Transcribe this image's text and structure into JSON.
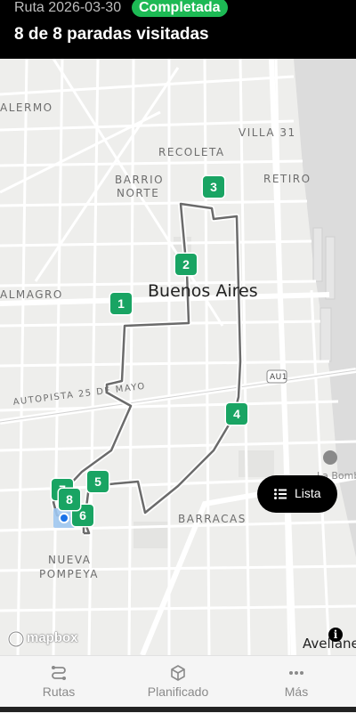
{
  "header": {
    "route_date": "Ruta 2026-03-30",
    "status": "Completada",
    "title": "8 de 8 paradas visitadas"
  },
  "map": {
    "city": "Buenos Aires",
    "labels": {
      "almagro_top": "ALERMO",
      "recoleta": "RECOLETA",
      "villa31": "VILLA 31",
      "barrio_norte_1": "BARRIO",
      "barrio_norte_2": "NORTE",
      "retiro": "RETIRO",
      "almagro": "ALMAGRO",
      "autopista": "AUTOPISTA 25 DE MAYO",
      "au1": "AU1",
      "barracas": "BARRACAS",
      "nueva_pompeya_1": "NUEVA",
      "nueva_pompeya_2": "POMPEYA",
      "la_bombonera": "La Bombone",
      "avellaneda": "Avellane"
    },
    "stops": [
      "1",
      "2",
      "3",
      "4",
      "5",
      "6",
      "7",
      "8"
    ],
    "route_color": "#6b6b6b",
    "stop_color": "#19a463"
  },
  "list_button": {
    "label": "Lista",
    "icon": "list-icon"
  },
  "attribution": {
    "logo": "mapbox",
    "info_icon": "i"
  },
  "nav": {
    "items": [
      {
        "label": "Rutas",
        "icon": "route-icon"
      },
      {
        "label": "Planificado",
        "icon": "box-icon"
      },
      {
        "label": "Más",
        "icon": "more-icon"
      }
    ]
  },
  "colors": {
    "status_green": "#1db954",
    "header_bg": "#000000",
    "nav_bg": "#f5f5f5"
  }
}
